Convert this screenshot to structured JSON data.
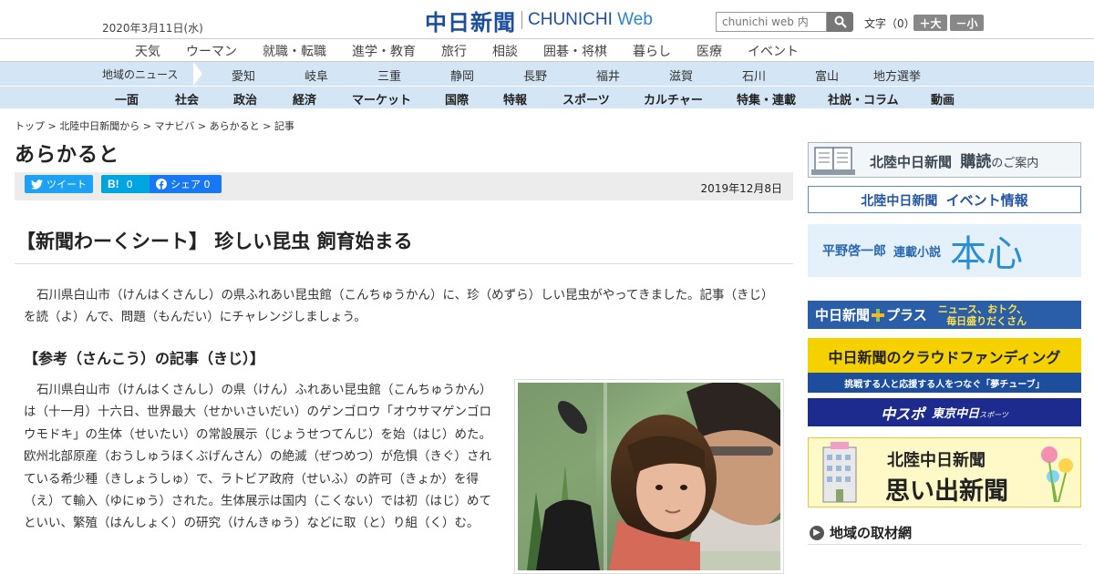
{
  "header": {
    "date": "2020年3月11日(水)",
    "logo_jp": "中日新聞",
    "logo_en_a": "CHUNICHI",
    "logo_en_b": " Web",
    "search_placeholder": "chunichi web 内",
    "font_label": "文字（0）",
    "font_up": "＋大",
    "font_down": "－小"
  },
  "nav_main": [
    "天気",
    "ウーマン",
    "就職・転職",
    "進学・教育",
    "旅行",
    "相談",
    "囲碁・将棋",
    "暮らし",
    "医療",
    "イベント"
  ],
  "nav_region": {
    "label": "地域のニュース",
    "items": [
      "愛知",
      "岐阜",
      "三重",
      "静岡",
      "長野",
      "福井",
      "滋賀",
      "石川",
      "富山",
      "地方選挙"
    ]
  },
  "nav_category": [
    "一面",
    "社会",
    "政治",
    "経済",
    "マーケット",
    "国際",
    "特報",
    "スポーツ",
    "カルチャー",
    "特集・連載",
    "社説・コラム",
    "動画"
  ],
  "breadcrumb": [
    "トップ",
    "北陸中日新聞から",
    "マナビバ",
    "あらかると",
    "記事"
  ],
  "section_title": "あらかると",
  "share": {
    "tweet": "ツイート",
    "hatena_count": "0",
    "facebook": "シェア 0",
    "date": "2019年12月8日"
  },
  "article": {
    "headline": "【新聞わーくシート】 珍しい昆虫 飼育始まる",
    "lead": "石川県白山市（けんはくさんし）の県ふれあい昆虫館（こんちゅうかん）に、珍（めずら）しい昆虫がやってきました。記事（きじ）を読（よ）んで、問題（もんだい）にチャレンジしましょう。",
    "subhead": "【参考（さんこう）の記事（きじ）】",
    "body": "石川県白山市（けんはくさんし）の県（けん）ふれあい昆虫館（こんちゅうかん）は（十一月）十六日、世界最大（せかいさいだい）のゲンゴロウ「オウサマゲンゴロウモドキ」の生体（せいたい）の常設展示（じょうせつてんじ）を始（はじ）めた。欧州北部原産（おうしゅうほくぶげんさん）の絶滅（ぜつめつ）が危惧（きぐ）されている希少種（きしょうしゅ）で、ラトビア政府（せいふ）の許可（きょか）を得（え）て輸入（ゆにゅう）された。生体展示は国内（こくない）では初（はじ）めてといい、繁殖（はんしょく）の研究（けんきゅう）などに取（と）り組（く）む。"
  },
  "sidebar": {
    "subscribe_a": "北陸中日新聞",
    "subscribe_b": "購読",
    "subscribe_c": "のご案内",
    "event_a": "北陸中日新聞",
    "event_b": "イベント情報",
    "novel_author": "平野啓一郎",
    "novel_label": "連載小説",
    "novel_title": "本心",
    "plus_a": "中日新聞",
    "plus_b": "プラス",
    "plus_tag1": "ニュース、おトク、",
    "plus_tag2": "毎日盛りだくさん",
    "crowd_title": "中日新聞のクラウドファンディング",
    "crowd_sub": "挑戦する人と応援する人をつなぐ「夢チューブ」",
    "chuspo_a": "中スポ",
    "chuspo_b": "東京中日",
    "chuspo_c": "スポーツ",
    "omoide_a": "北陸中日新聞",
    "omoide_b": "思い出新聞",
    "local": "地域の取材網"
  },
  "colors": {
    "brand": "#1c4e9e",
    "nav_bg": "#d4e6f5",
    "twitter": "#1da1f2",
    "hatena": "#00a4de",
    "facebook": "#1877f2"
  }
}
